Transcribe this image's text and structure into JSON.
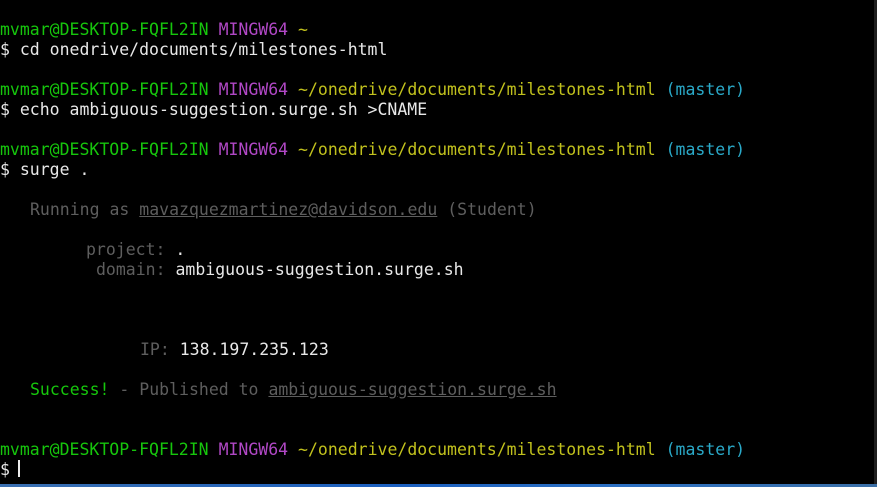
{
  "prompt": {
    "user_host": "mvmar@DESKTOP-FQFL2IN",
    "shell": "MINGW64",
    "home_path": "~",
    "project_path": "~/onedrive/documents/milestones-html",
    "branch": "(master)",
    "symbol": "$"
  },
  "commands": {
    "cd": "cd onedrive/documents/milestones-html",
    "echo": "echo ambiguous-suggestion.surge.sh >CNAME",
    "surge": "surge ."
  },
  "surge_output": {
    "running_as_label": "Running as",
    "account_email": "mavazquezmartinez@davidson.edu",
    "account_type": "(Student)",
    "project_label": "project:",
    "project_value": ".",
    "domain_label": "domain:",
    "domain_value": "ambiguous-suggestion.surge.sh",
    "ip_label": "IP:",
    "ip_value": "138.197.235.123",
    "success_label": "Success!",
    "published_text": "- Published to",
    "published_url": "ambiguous-suggestion.surge.sh"
  },
  "colors": {
    "background": "#000000",
    "user_green": "#16c60c",
    "host_magenta": "#b148c6",
    "path_yellow": "#c1c11d",
    "branch_cyan": "#2aa9c8",
    "dim_gray": "#5e5e5e"
  }
}
